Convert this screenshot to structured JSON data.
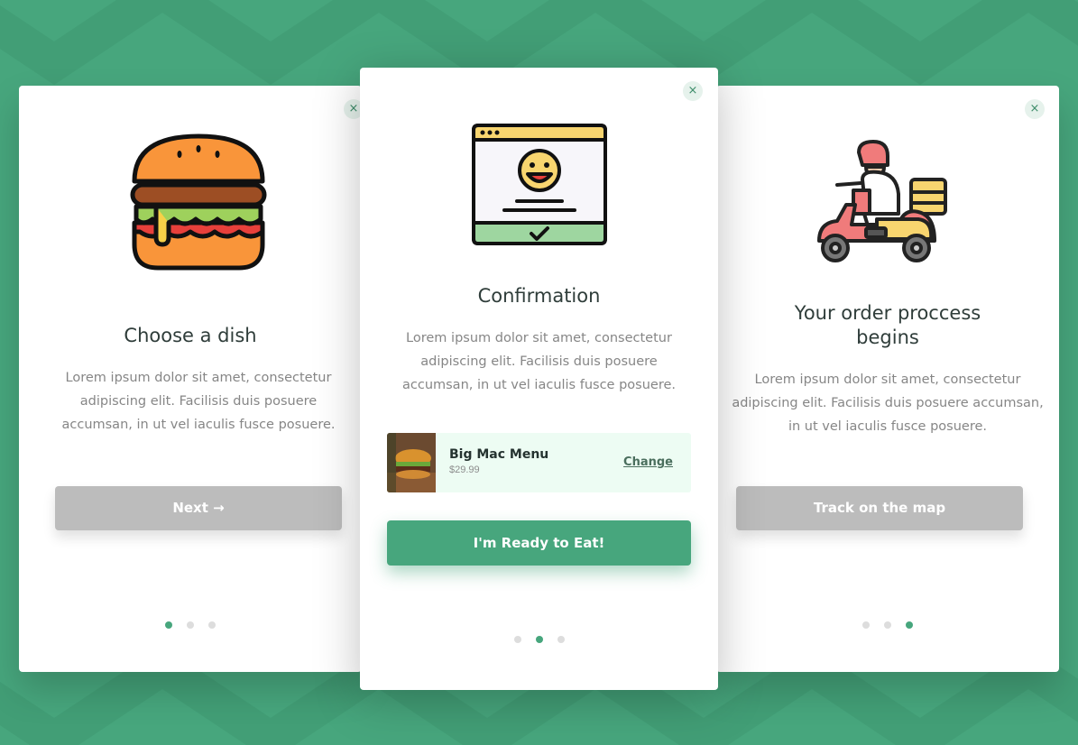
{
  "colors": {
    "background": "#47a67d",
    "accent": "#47a67d",
    "button_disabled": "#bcbcbc",
    "order_bg": "#edfcf3"
  },
  "cards": [
    {
      "title": "Choose a dish",
      "description": "Lorem ipsum dolor sit amet, consectetur adipiscing elit. Facilisis duis posuere accumsan, in ut vel iaculis fusce posuere.",
      "button_label": "Next →",
      "illustration": "burger-icon",
      "close_icon": "×",
      "dots_active": 1
    },
    {
      "title": "Confirmation",
      "description": "Lorem ipsum dolor sit amet, consectetur adipiscing elit. Facilisis duis posuere accumsan, in ut vel iaculis fusce posuere.",
      "button_label": "I'm Ready to Eat!",
      "illustration": "confirmation-window-icon",
      "close_icon": "×",
      "dots_active": 2,
      "order": {
        "name": "Big Mac Menu",
        "price": "$29.99",
        "change_label": "Change"
      }
    },
    {
      "title": "Your order proccess begins",
      "description": "Lorem ipsum dolor sit amet, consectetur adipiscing elit. Facilisis duis posuere accumsan, in ut vel iaculis fusce posuere.",
      "button_label": "Track on the map",
      "illustration": "delivery-scooter-icon",
      "close_icon": "×",
      "dots_active": 3
    }
  ]
}
